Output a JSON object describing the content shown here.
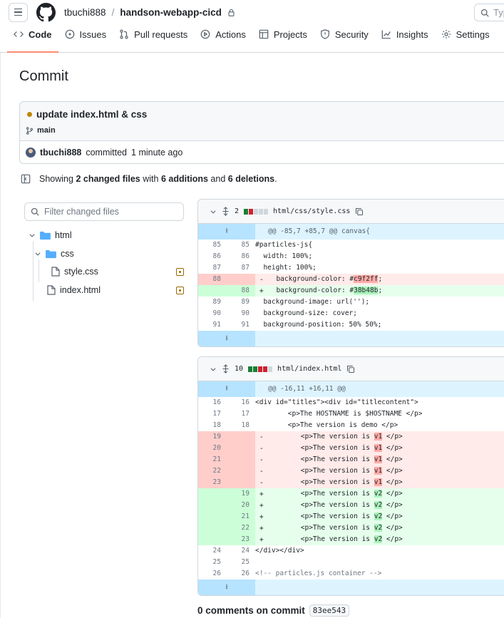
{
  "header": {
    "owner": "tbuchi888",
    "separator": "/",
    "repo": "handson-webapp-cicd",
    "search_placeholder": "Typ"
  },
  "tabs": [
    {
      "label": "Code",
      "icon": "code-icon",
      "active": true
    },
    {
      "label": "Issues",
      "icon": "issue-icon"
    },
    {
      "label": "Pull requests",
      "icon": "pull-request-icon"
    },
    {
      "label": "Actions",
      "icon": "play-icon"
    },
    {
      "label": "Projects",
      "icon": "table-icon"
    },
    {
      "label": "Security",
      "icon": "shield-icon"
    },
    {
      "label": "Insights",
      "icon": "graph-icon"
    },
    {
      "label": "Settings",
      "icon": "gear-icon"
    }
  ],
  "page_title": "Commit",
  "commit": {
    "message": "update index.html & css",
    "branch": "main",
    "author": "tbuchi888",
    "action": "committed",
    "time": "1 minute ago"
  },
  "summary": {
    "prefix": "Showing",
    "files": "2 changed files",
    "with": "with",
    "additions": "6 additions",
    "and": "and",
    "deletions": "6 deletions",
    "end": "."
  },
  "filter_placeholder": "Filter changed files",
  "tree": {
    "html": "html",
    "css": "css",
    "style": "style.css",
    "index": "index.html"
  },
  "diff1": {
    "count": "2",
    "path": "html/css/style.css",
    "hunk": "@@ -85,7 +85,7 @@ canvas{",
    "rows": [
      {
        "o": "85",
        "n": "85",
        "s": " ",
        "t": "ctx",
        "c": "#particles-js{"
      },
      {
        "o": "86",
        "n": "86",
        "s": " ",
        "t": "ctx",
        "c": "  width: 100%;"
      },
      {
        "o": "87",
        "n": "87",
        "s": " ",
        "t": "ctx",
        "c": "  height: 100%;"
      },
      {
        "o": "88",
        "n": "",
        "s": "-",
        "t": "del",
        "c": "  background-color: #",
        "h": "c9f2ff",
        "c2": ";"
      },
      {
        "o": "",
        "n": "88",
        "s": "+",
        "t": "add",
        "c": "  background-color: #",
        "h": "38b48b",
        "c2": ";"
      },
      {
        "o": "89",
        "n": "89",
        "s": " ",
        "t": "ctx",
        "c": "  background-image: url('');"
      },
      {
        "o": "90",
        "n": "90",
        "s": " ",
        "t": "ctx",
        "c": "  background-size: cover;"
      },
      {
        "o": "91",
        "n": "91",
        "s": " ",
        "t": "ctx",
        "c": "  background-position: 50% 50%;"
      }
    ]
  },
  "diff2": {
    "count": "10",
    "path": "html/index.html",
    "hunk": "@@ -16,11 +16,11 @@",
    "rows": [
      {
        "o": "16",
        "n": "16",
        "s": " ",
        "t": "ctx",
        "c": "<div id=\"titles\"><div id=\"titlecontent\">"
      },
      {
        "o": "17",
        "n": "17",
        "s": " ",
        "t": "ctx",
        "c": "        <p>The HOSTNAME is $HOSTNAME </p>"
      },
      {
        "o": "18",
        "n": "18",
        "s": " ",
        "t": "ctx",
        "c": "        <p>The version is demo </p>"
      },
      {
        "o": "19",
        "n": "",
        "s": "-",
        "t": "del",
        "c": "        <p>The version is ",
        "h": "v1",
        "c2": " </p>"
      },
      {
        "o": "20",
        "n": "",
        "s": "-",
        "t": "del",
        "c": "        <p>The version is ",
        "h": "v1",
        "c2": " </p>"
      },
      {
        "o": "21",
        "n": "",
        "s": "-",
        "t": "del",
        "c": "        <p>The version is ",
        "h": "v1",
        "c2": " </p>"
      },
      {
        "o": "22",
        "n": "",
        "s": "-",
        "t": "del",
        "c": "        <p>The version is ",
        "h": "v1",
        "c2": " </p>"
      },
      {
        "o": "23",
        "n": "",
        "s": "-",
        "t": "del",
        "c": "        <p>The version is ",
        "h": "v1",
        "c2": " </p>"
      },
      {
        "o": "",
        "n": "19",
        "s": "+",
        "t": "add",
        "c": "        <p>The version is ",
        "h": "v2",
        "c2": " </p>"
      },
      {
        "o": "",
        "n": "20",
        "s": "+",
        "t": "add",
        "c": "        <p>The version is ",
        "h": "v2",
        "c2": " </p>"
      },
      {
        "o": "",
        "n": "21",
        "s": "+",
        "t": "add",
        "c": "        <p>The version is ",
        "h": "v2",
        "c2": " </p>"
      },
      {
        "o": "",
        "n": "22",
        "s": "+",
        "t": "add",
        "c": "        <p>The version is ",
        "h": "v2",
        "c2": " </p>"
      },
      {
        "o": "",
        "n": "23",
        "s": "+",
        "t": "add",
        "c": "        <p>The version is ",
        "h": "v2",
        "c2": " </p>"
      },
      {
        "o": "24",
        "n": "24",
        "s": " ",
        "t": "ctx",
        "c": "</div></div>"
      },
      {
        "o": "25",
        "n": "25",
        "s": " ",
        "t": "ctx",
        "c": ""
      },
      {
        "o": "26",
        "n": "26",
        "s": " ",
        "t": "ctx",
        "c": "<!-- particles.js container -->"
      }
    ]
  },
  "comments": {
    "label": "0 comments on commit",
    "sha": "83ee543"
  },
  "colors": {
    "accent_tab": "#fd8c73",
    "add_bg": "#e6ffec",
    "del_bg": "#ffebe9",
    "folder": "#54aeff"
  }
}
